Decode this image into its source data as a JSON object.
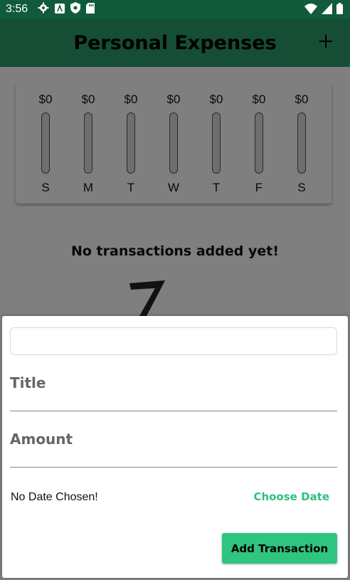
{
  "status_bar": {
    "time": "3:56",
    "left_icons": [
      "gear-icon",
      "a-box-icon",
      "shield-icon",
      "sdcard-icon"
    ],
    "right_icons": [
      "wifi-icon",
      "signal-icon",
      "battery-icon"
    ]
  },
  "app_bar": {
    "title": "Personal Expenses",
    "add_icon": "plus-icon",
    "color": "#2a9c69"
  },
  "chart": {
    "days": [
      {
        "day": "S",
        "amount": "$0",
        "fraction": 0
      },
      {
        "day": "M",
        "amount": "$0",
        "fraction": 0
      },
      {
        "day": "T",
        "amount": "$0",
        "fraction": 0
      },
      {
        "day": "W",
        "amount": "$0",
        "fraction": 0
      },
      {
        "day": "T",
        "amount": "$0",
        "fraction": 0
      },
      {
        "day": "F",
        "amount": "$0",
        "fraction": 0
      },
      {
        "day": "S",
        "amount": "$0",
        "fraction": 0
      }
    ]
  },
  "empty_state": {
    "message": "No transactions added yet!"
  },
  "sheet": {
    "top_input_value": "",
    "title_label": "Title",
    "amount_label": "Amount",
    "date_text": "No Date Chosen!",
    "choose_date_label": "Choose Date",
    "add_button_label": "Add Transaction",
    "accent": "#2fc47f"
  }
}
